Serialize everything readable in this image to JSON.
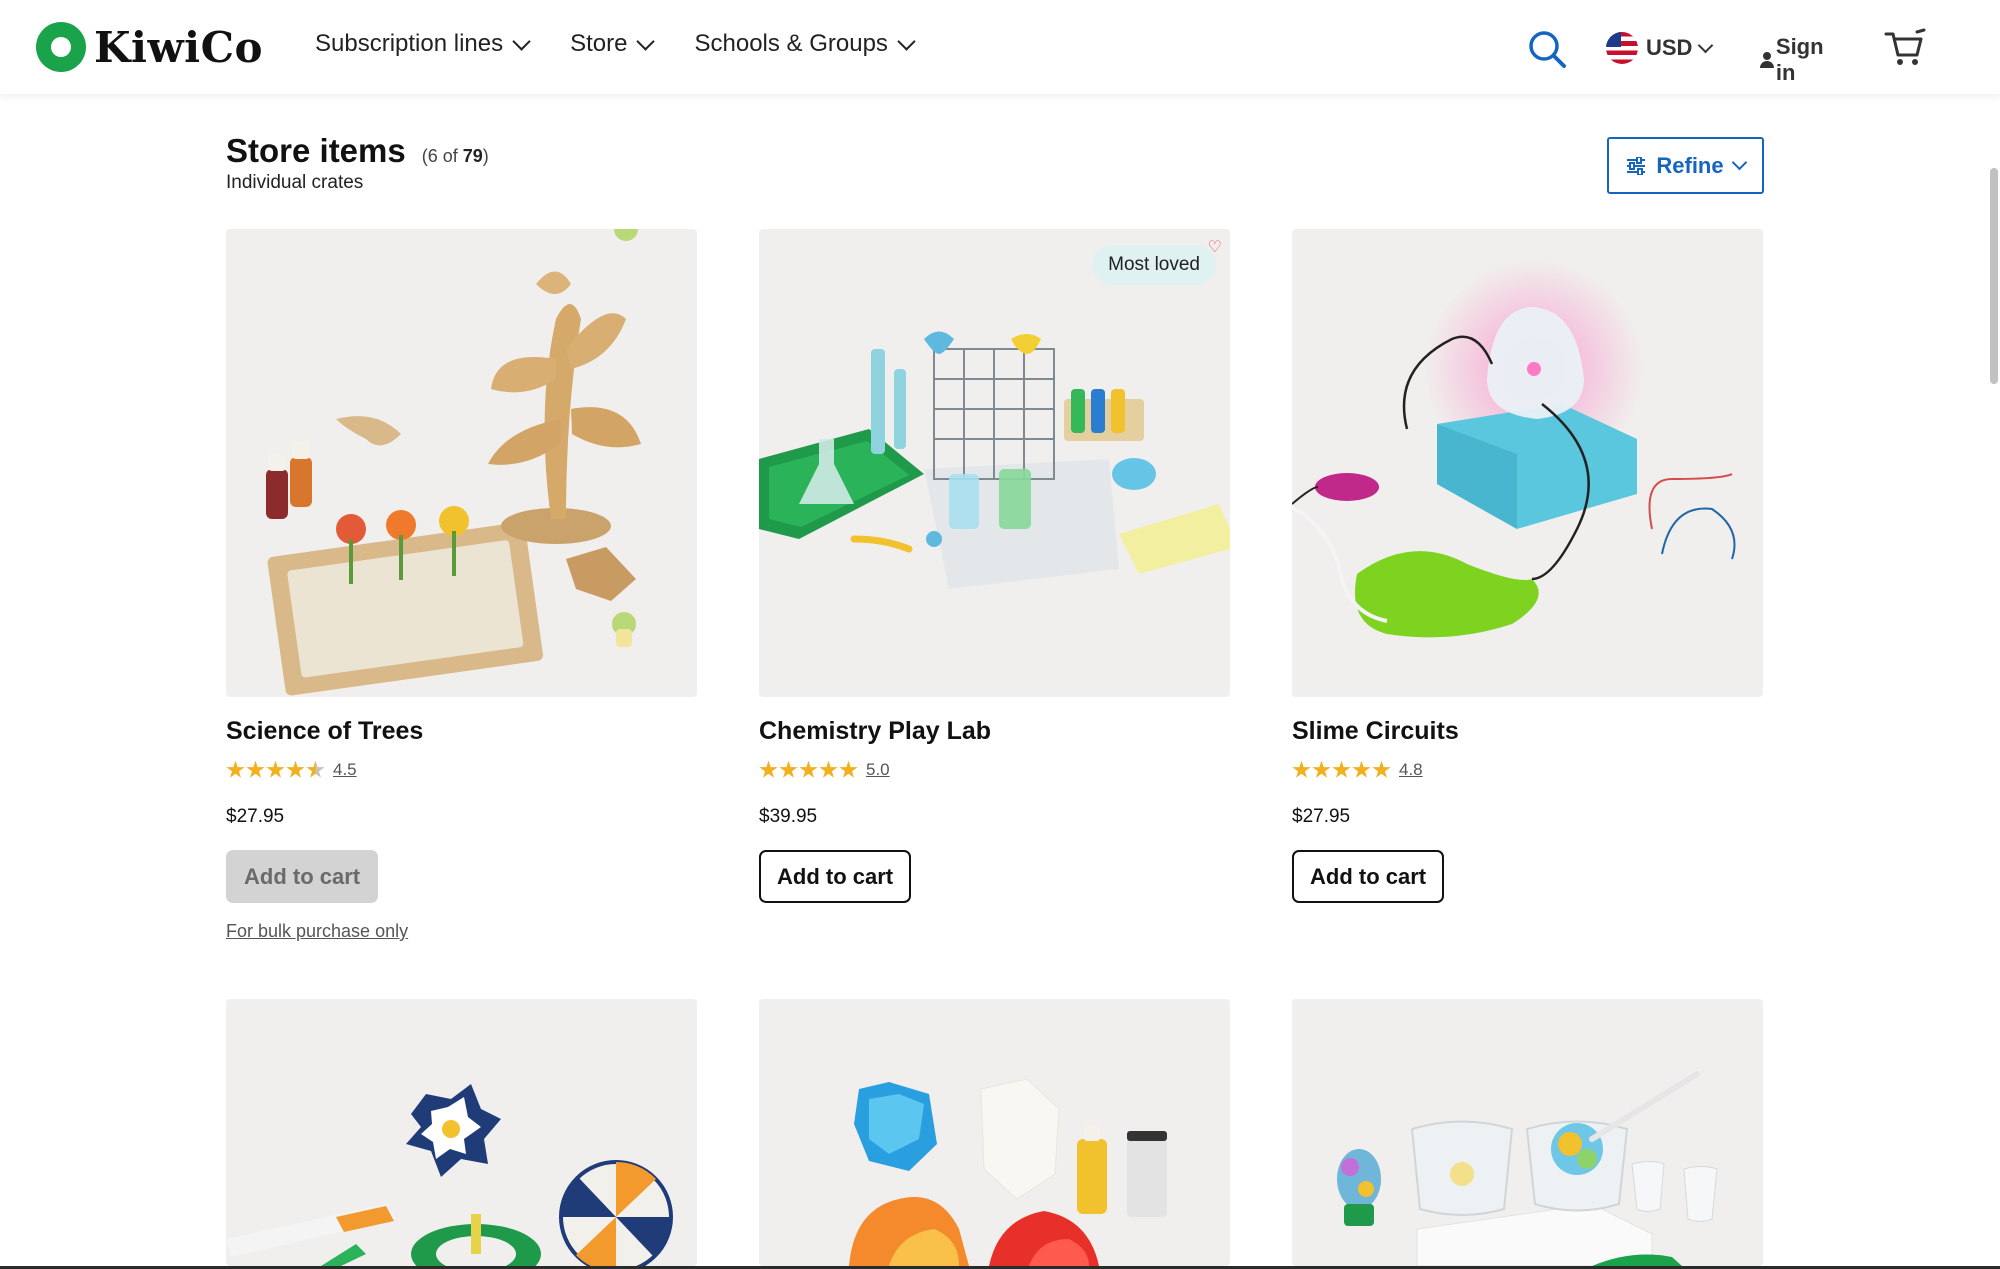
{
  "header": {
    "logo_text": "KiwiCo",
    "nav": [
      {
        "label": "Subscription lines"
      },
      {
        "label": "Store"
      },
      {
        "label": "Schools & Groups"
      }
    ],
    "currency": "USD",
    "signin": "Sign in"
  },
  "page": {
    "title": "Store items",
    "count_prefix": "(6 of ",
    "count_total": "79",
    "count_suffix": ")",
    "subtitle": "Individual crates",
    "refine_label": "Refine"
  },
  "products": [
    {
      "name": "Science of Trees",
      "rating": "4.5",
      "price": "$27.95",
      "button": "Add to cart",
      "note": "For bulk purchase only"
    },
    {
      "name": "Chemistry Play Lab",
      "rating": "5.0",
      "price": "$39.95",
      "button": "Add to cart",
      "badge": "Most loved"
    },
    {
      "name": "Slime Circuits",
      "rating": "4.8",
      "price": "$27.95",
      "button": "Add to cart"
    }
  ],
  "colors": {
    "brand_green": "#1aa34a",
    "link_blue": "#1565c0",
    "star": "#f2b01e",
    "card_bg": "#f1efed"
  },
  "icons": [
    "search-icon",
    "chevron-down-icon",
    "flag-us-icon",
    "user-icon",
    "cart-icon",
    "sliders-icon",
    "heart-icon",
    "star-icon"
  ]
}
